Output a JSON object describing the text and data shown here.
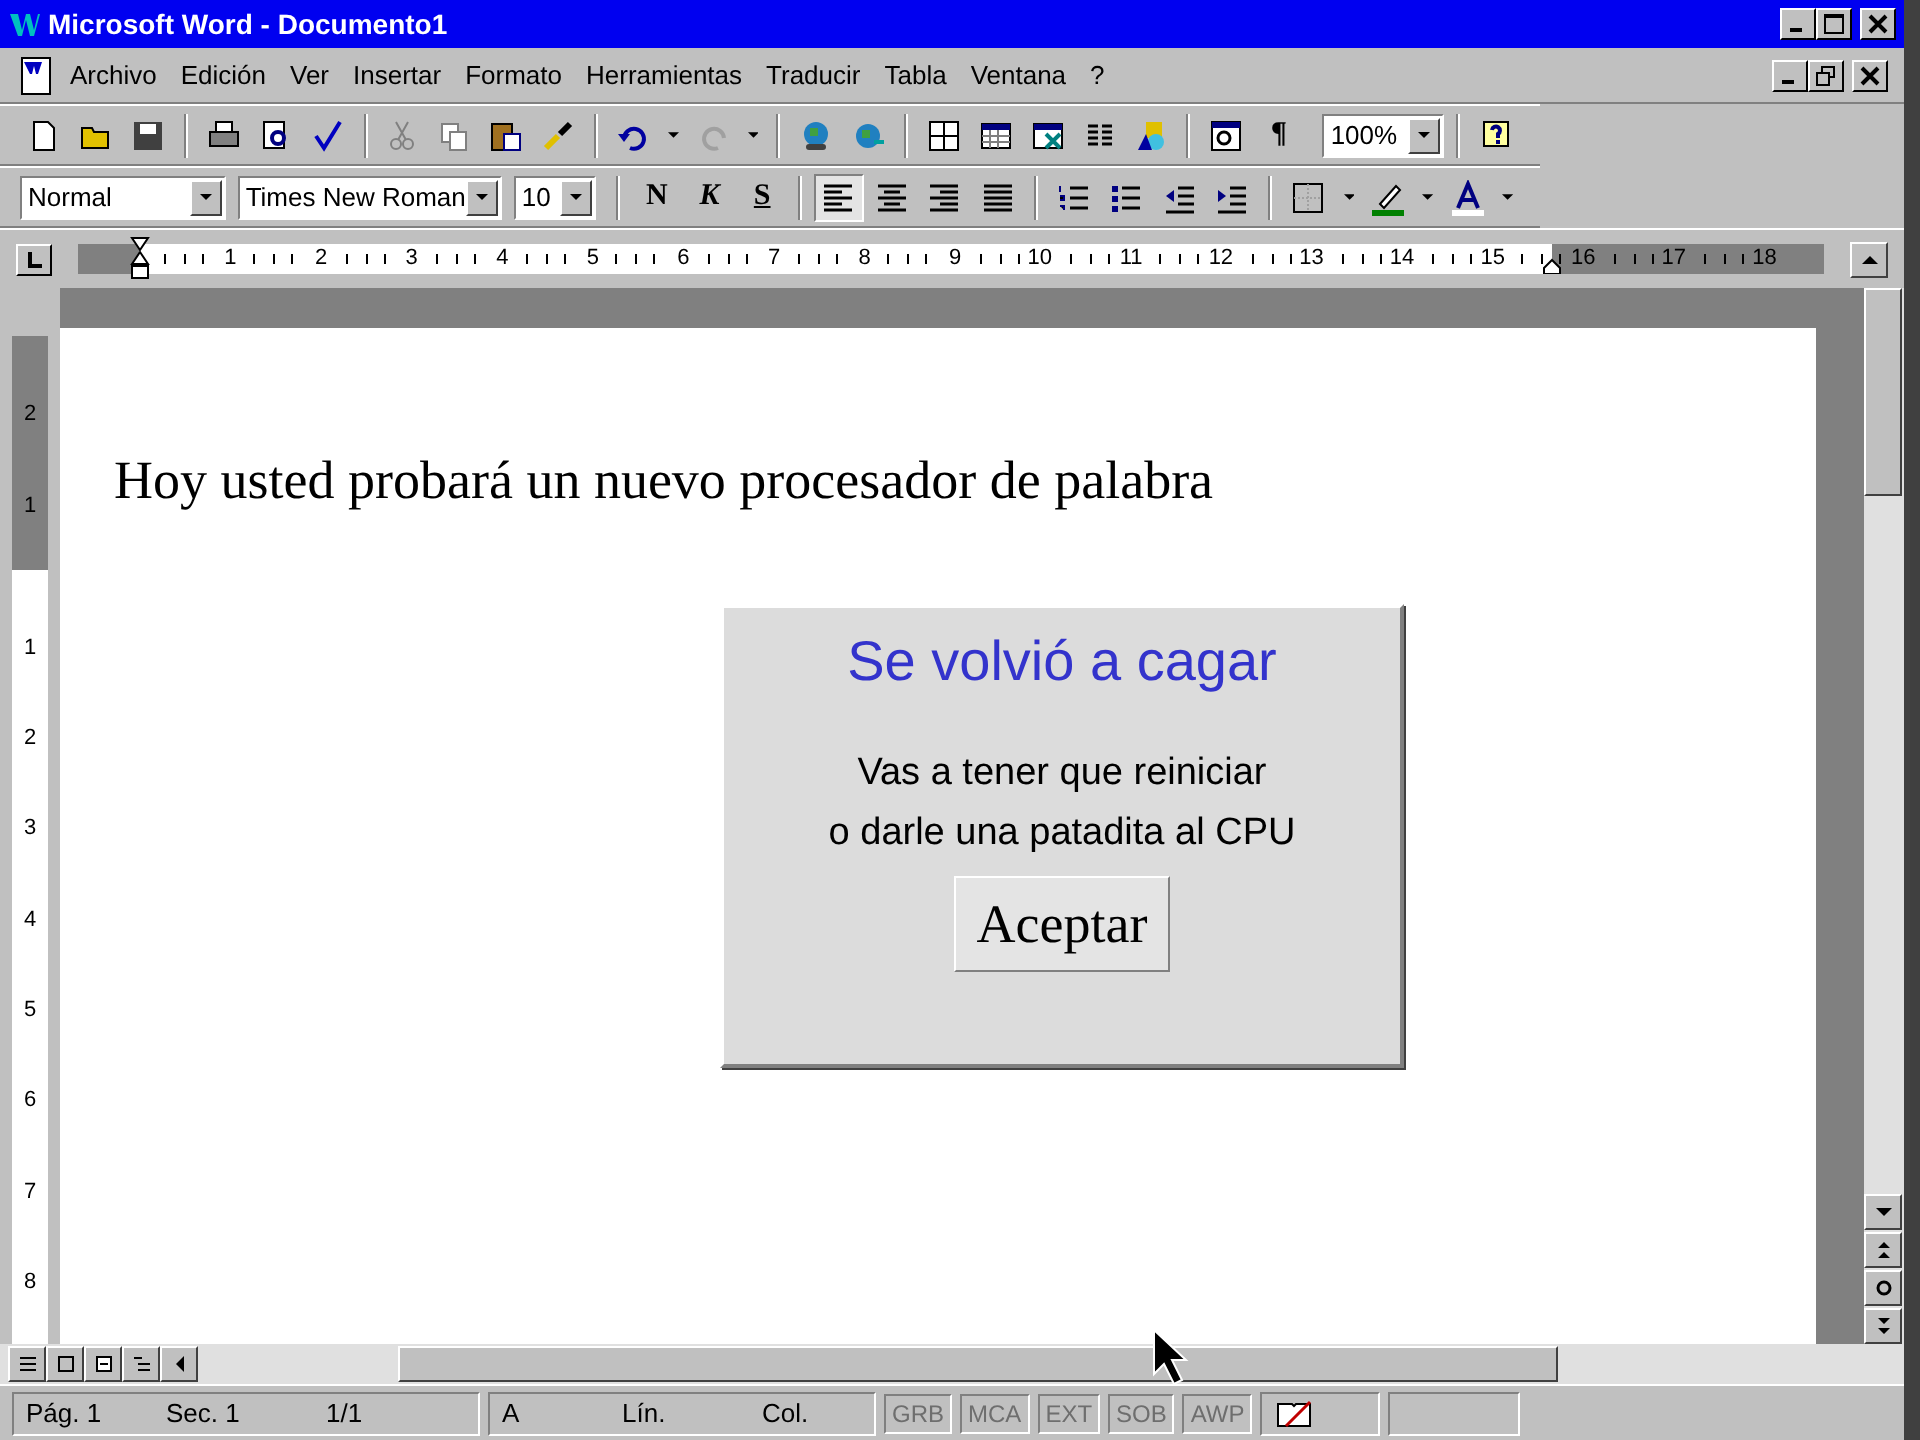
{
  "window": {
    "title": "Microsoft Word - Documento1"
  },
  "menu": [
    {
      "label": "Archivo"
    },
    {
      "label": "Edición"
    },
    {
      "label": "Ver"
    },
    {
      "label": "Insertar"
    },
    {
      "label": "Formato"
    },
    {
      "label": "Herramientas"
    },
    {
      "label": "Traducir"
    },
    {
      "label": "Tabla"
    },
    {
      "label": "Ventana"
    },
    {
      "label": "?"
    }
  ],
  "standard_toolbar": {
    "pilcrow": "¶",
    "zoom": "100%"
  },
  "formatting_toolbar": {
    "style": "Normal",
    "font": "Times New Roman",
    "size": "10",
    "format_buttons": [
      {
        "label": "N",
        "kind": "bold"
      },
      {
        "label": "K",
        "kind": "italic"
      },
      {
        "label": "S",
        "kind": "underline"
      }
    ],
    "align_buttons": [
      {
        "selected": true
      },
      {
        "selected": false
      },
      {
        "selected": false
      },
      {
        "selected": false
      }
    ]
  },
  "horizontal_ruler": {
    "numbers": [
      "1",
      "2",
      "3",
      "4",
      "5",
      "6",
      "7",
      "8",
      "9",
      "10",
      "11",
      "12",
      "13",
      "14",
      "15",
      "16",
      "17",
      "18"
    ]
  },
  "vertical_ruler": {
    "top_numbers": [
      "2",
      "1"
    ],
    "numbers": [
      "1",
      "2",
      "3",
      "4",
      "5",
      "6",
      "7",
      "8"
    ]
  },
  "document": {
    "text": "Hoy usted probará un nuevo procesador de palabra"
  },
  "dialog": {
    "title": "Se volvió a cagar",
    "message_lines": [
      "Vas a tener que reiniciar",
      "o darle una patadita al CPU"
    ],
    "button": "Aceptar"
  },
  "status_bar": {
    "panels": [
      {
        "items": [
          "Pág. 1",
          "Sec. 1",
          "1/1"
        ]
      },
      {
        "items": [
          "A",
          "Lín.",
          "Col."
        ]
      }
    ],
    "indicators": [
      {
        "label": "GRB",
        "disabled": true
      },
      {
        "label": "MCA",
        "disabled": true
      },
      {
        "label": "EXT",
        "disabled": true
      },
      {
        "label": "SOB",
        "disabled": true
      },
      {
        "label": "AWP",
        "disabled": true
      }
    ]
  }
}
